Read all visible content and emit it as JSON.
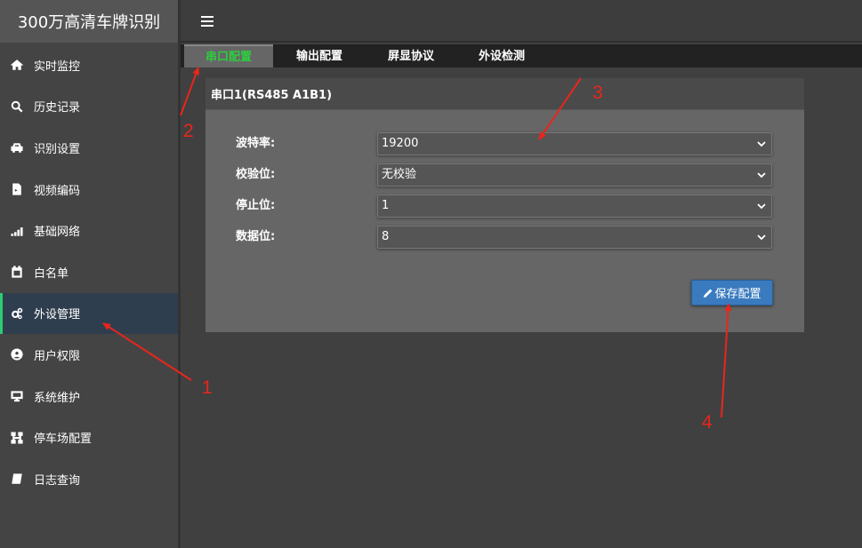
{
  "app": {
    "title": "300万高清车牌识别"
  },
  "sidebar": {
    "items": [
      {
        "label": "实时监控",
        "icon": "home-icon"
      },
      {
        "label": "历史记录",
        "icon": "search-icon"
      },
      {
        "label": "识别设置",
        "icon": "car-icon"
      },
      {
        "label": "视频编码",
        "icon": "file-video-icon"
      },
      {
        "label": "基础网络",
        "icon": "signal-icon"
      },
      {
        "label": "白名单",
        "icon": "calendar-icon"
      },
      {
        "label": "外设管理",
        "icon": "gears-icon",
        "active": true
      },
      {
        "label": "用户权限",
        "icon": "user-circle-icon"
      },
      {
        "label": "系统维护",
        "icon": "monitor-icon"
      },
      {
        "label": "停车场配置",
        "icon": "network-icon"
      },
      {
        "label": "日志查询",
        "icon": "book-icon"
      }
    ]
  },
  "tabs": [
    {
      "label": "串口配置",
      "active": true
    },
    {
      "label": "输出配置"
    },
    {
      "label": "屏显协议"
    },
    {
      "label": "外设检测"
    }
  ],
  "panel": {
    "title": "串口1(RS485 A1B1)",
    "fields": [
      {
        "label": "波特率:",
        "value": "19200"
      },
      {
        "label": "校验位:",
        "value": "无校验"
      },
      {
        "label": "停止位:",
        "value": "1"
      },
      {
        "label": "数据位:",
        "value": "8"
      }
    ],
    "save_label": "保存配置"
  },
  "annotations": [
    "1",
    "2",
    "3",
    "4"
  ],
  "colors": {
    "active_tab_text": "#2ecc40",
    "active_menu_indicator": "#2ecc71",
    "save_button": "#3a7bbf",
    "annotation": "#e8261c"
  }
}
